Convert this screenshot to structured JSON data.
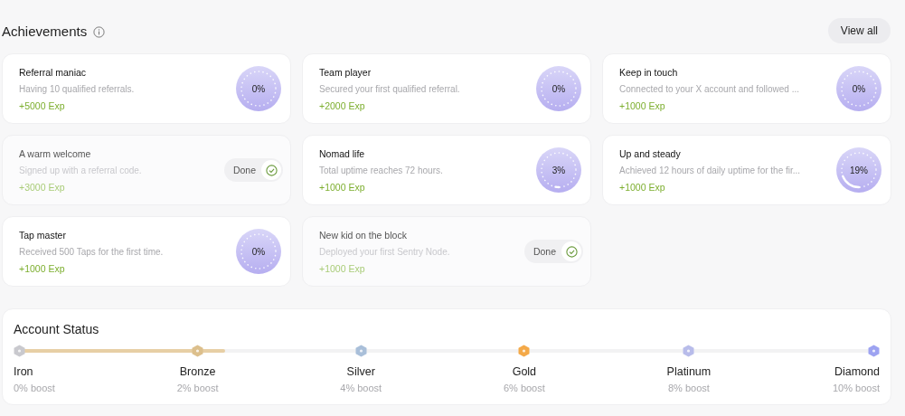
{
  "header": {
    "title": "Achievements",
    "view_all": "View all"
  },
  "achievements": [
    {
      "kind": "progress",
      "title": "Referral maniac",
      "description": "Having 10 qualified referrals.",
      "reward": "+5000 Exp",
      "reading": "0%"
    },
    {
      "kind": "progress",
      "title": "Team player",
      "description": "Secured your first qualified referral.",
      "reward": "+2000 Exp",
      "reading": "0%"
    },
    {
      "kind": "progress",
      "title": "Keep in touch",
      "description": "Connected to your X account and followed ...",
      "reward": "+1000 Exp",
      "reading": "0%"
    },
    {
      "kind": "done",
      "title": "A warm welcome",
      "description": "Signed up with a referral code.",
      "reward": "+3000 Exp",
      "status": "Done"
    },
    {
      "kind": "progress",
      "title": "Nomad life",
      "description": "Total uptime reaches 72 hours.",
      "reward": "+1000 Exp",
      "reading": "3%"
    },
    {
      "kind": "progress",
      "title": "Up and steady",
      "description": "Achieved 12 hours of daily uptime for the fir...",
      "reward": "+1000 Exp",
      "reading": "19%"
    },
    {
      "kind": "progress",
      "title": "Tap master",
      "description": "Received 500 Taps for the first time.",
      "reward": "+1000 Exp",
      "reading": "0%"
    },
    {
      "kind": "done",
      "title": "New kid on the block",
      "description": "Deployed your first Sentry Node.",
      "reward": "+1000 Exp",
      "status": "Done"
    }
  ],
  "account_status": {
    "title": "Account Status",
    "level": 0.24,
    "tiers": [
      {
        "name": "Iron",
        "boost": "0% boost",
        "color": "#c9c9ce"
      },
      {
        "name": "Bronze",
        "boost": "2% boost",
        "color": "#dcbf8c"
      },
      {
        "name": "Silver",
        "boost": "4% boost",
        "color": "#a9bfd9"
      },
      {
        "name": "Gold",
        "boost": "6% boost",
        "color": "#f4a948"
      },
      {
        "name": "Platinum",
        "boost": "8% boost",
        "color": "#b8bcea"
      },
      {
        "name": "Diamond",
        "boost": "10% boost",
        "color": "#9da3f1"
      }
    ]
  }
}
